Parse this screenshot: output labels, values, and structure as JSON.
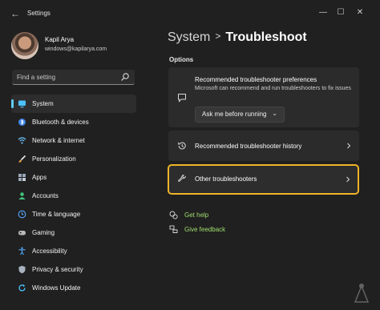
{
  "window": {
    "title": "Settings"
  },
  "profile": {
    "name": "Kapil Arya",
    "email": "windows@kapilarya.com"
  },
  "search": {
    "placeholder": "Find a setting",
    "icon": "search-icon"
  },
  "sidebar": {
    "items": [
      {
        "label": "System",
        "icon": "system-icon",
        "active": true,
        "color": "#4cc2ff"
      },
      {
        "label": "Bluetooth & devices",
        "icon": "bluetooth-icon",
        "active": false,
        "color": "#4c9dff"
      },
      {
        "label": "Network & internet",
        "icon": "network-icon",
        "active": false,
        "color": "#6fc3ff"
      },
      {
        "label": "Personalization",
        "icon": "brush-icon",
        "active": false,
        "color": "#f4a54b"
      },
      {
        "label": "Apps",
        "icon": "apps-icon",
        "active": false,
        "color": "#9aa7b8"
      },
      {
        "label": "Accounts",
        "icon": "accounts-icon",
        "active": false,
        "color": "#3fc47a"
      },
      {
        "label": "Time & language",
        "icon": "time-language-icon",
        "active": false,
        "color": "#5aa9ff"
      },
      {
        "label": "Gaming",
        "icon": "gaming-icon",
        "active": false,
        "color": "#b9b9b9"
      },
      {
        "label": "Accessibility",
        "icon": "accessibility-icon",
        "active": false,
        "color": "#4fb0ff"
      },
      {
        "label": "Privacy & security",
        "icon": "shield-icon",
        "active": false,
        "color": "#a9b3bf"
      },
      {
        "label": "Windows Update",
        "icon": "update-icon",
        "active": false,
        "color": "#4cc2ff"
      }
    ]
  },
  "breadcrumb": {
    "parent": "System",
    "separator": ">",
    "current": "Troubleshoot"
  },
  "main": {
    "section_label": "Options",
    "cards": {
      "preferences": {
        "title": "Recommended troubleshooter preferences",
        "description": "Microsoft can recommend and run troubleshooters to fix issues",
        "dropdown_value": "Ask me before running",
        "icon": "chat-icon"
      },
      "history": {
        "title": "Recommended troubleshooter history",
        "icon": "history-icon"
      },
      "other": {
        "title": "Other troubleshooters",
        "icon": "wrench-icon",
        "highlight_color": "#f0b429"
      }
    },
    "links": [
      {
        "label": "Get help",
        "icon": "help-icon"
      },
      {
        "label": "Give feedback",
        "icon": "feedback-icon"
      }
    ],
    "link_color": "#9fdd6e"
  },
  "colors": {
    "background": "#202020",
    "card": "#2b2b2b",
    "accent": "#60cdff"
  }
}
